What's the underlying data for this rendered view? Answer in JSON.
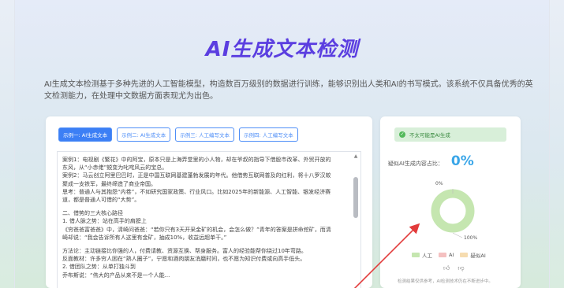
{
  "header": {
    "title": "AI生成文本检测",
    "description": "AI生成文本检测基于多种先进的人工智能模型，构造数百万级别的数据进行训练，能够识别出人类和AI的书写模式。该系统不仅具备优秀的英文检测能力，在处理中文数据方面表现尤为出色。"
  },
  "tabs": [
    {
      "label": "示例一: AI生成文本",
      "active": true
    },
    {
      "label": "示例二: AI生成文本",
      "active": false
    },
    {
      "label": "示例三: 人工编写文本",
      "active": false
    },
    {
      "label": "示例四: 人工编写文本",
      "active": false
    }
  ],
  "text_lines": [
    "案例1：电视剧《繁花》中的阿宝，原本只是上海弄堂里的小人物，却在爷叔的指导下借股市改革、外贸开放的",
    "东风，从“小赤佬”蜕变为叱咤风云的宝总。",
    "案例2：马云创立阿里巴巴时，正是中国互联网基建蓬勃发展的年代。他借势互联网普及的红利，将十八罗汉蛟",
    "聚成一支铁军，最终缔造了商业帝国。",
    "思考：普通人与其抱怨“内卷”，不如研究国家政策、行业风口。比如2025年的新能源、人工智能、银发经济赛",
    "道，都是普通人可借的“大势”。",
    "",
    "二、借势的三大核心路径",
    "1. 借人脉之势：站在高手的肩膀上",
    "《穷爸爸富爸爸》中，清崎问爸爸：“若你只有3天开采金矿的机会，会怎么做？”青年的答案是拼命挖矿，而清",
    "崎却说：“我会告诉所有人这里有金矿，抽成10%，收益远超单干。”",
    "",
    "方法论：主动链接比你强的人，付费请教、资源互换、帮身服务。富人的经验能帮你绕过10年弯路。",
    "反面教材：许多穷人困在“熟人圈子”，宁愿和酒肉朋友消磨时间，也不愿为知识付费或向高手低头。",
    "2. 借团队之势：从单打独斗到",
    "乔布斯说：“伟大的产品从来不是一个人能..."
  ],
  "result": {
    "badge_text": "不太可能是AI生成",
    "ratio_label": "疑似AI生成内容占比：",
    "ratio_value": "0%",
    "donut_top_label": "0%",
    "donut_bottom_label": "100%",
    "legend": [
      {
        "label": "人工",
        "color": "#c5e6b0"
      },
      {
        "label": "AI",
        "color": "#f4c0c0"
      },
      {
        "label": "疑似AI",
        "color": "#f6dcb0"
      }
    ],
    "thumb_up": "👍",
    "thumb_down": "👎",
    "note": "检测结果仅供参考，AI检测技术仍在不断进步中。"
  },
  "colors": {
    "accent": "#5b3ee0",
    "tab_blue": "#3c7ff5",
    "human": "#c5e6b0",
    "ratio": "#3aa6e8",
    "arrow": "#e23b3b"
  }
}
